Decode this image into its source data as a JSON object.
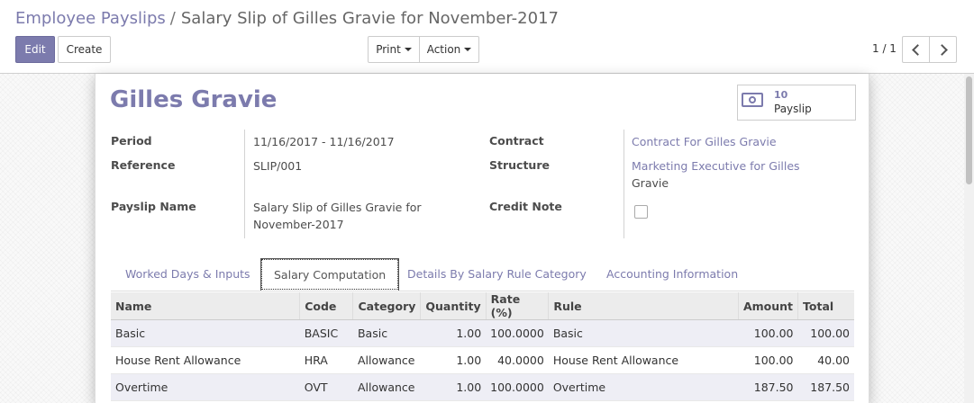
{
  "breadcrumb": {
    "parent": "Employee Payslips",
    "separator": "/",
    "current": "Salary Slip of Gilles Gravie for November-2017"
  },
  "toolbar": {
    "edit": "Edit",
    "create": "Create",
    "print": "Print",
    "action": "Action"
  },
  "pager": {
    "value": "1 / 1"
  },
  "sheet": {
    "title": "Gilles Gravie",
    "smart_button": {
      "count": "10",
      "label": "Payslip",
      "icon": "money-icon"
    },
    "fields": {
      "period_label": "Period",
      "period_value": "11/16/2017 - 11/16/2017",
      "reference_label": "Reference",
      "reference_value": "SLIP/001",
      "payslip_name_label": "Payslip Name",
      "payslip_name_line1": "Salary Slip of Gilles Gravie for",
      "payslip_name_line2": "November-2017",
      "contract_label": "Contract",
      "contract_value": "Contract For Gilles Gravie",
      "structure_label": "Structure",
      "structure_line1": "Marketing Executive for Gilles",
      "structure_line2": "Gravie",
      "credit_note_label": "Credit Note",
      "credit_note_checked": false
    },
    "tabs": [
      {
        "label": "Worked Days & Inputs"
      },
      {
        "label": "Salary Computation"
      },
      {
        "label": "Details By Salary Rule Category"
      },
      {
        "label": "Accounting Information"
      }
    ],
    "table": {
      "headers": [
        "Name",
        "Code",
        "Category",
        "Quantity",
        "Rate (%)",
        "Rule",
        "Amount",
        "Total"
      ],
      "rows": [
        [
          "Basic",
          "BASIC",
          "Basic",
          "1.00",
          "100.0000",
          "Basic",
          "100.00",
          "100.00"
        ],
        [
          "House Rent Allowance",
          "HRA",
          "Allowance",
          "1.00",
          "40.0000",
          "House Rent Allowance",
          "100.00",
          "40.00"
        ],
        [
          "Overtime",
          "OVT",
          "Allowance",
          "1.00",
          "100.0000",
          "Overtime",
          "187.50",
          "187.50"
        ]
      ]
    }
  },
  "colors": {
    "brand": "#7c7bad",
    "row_alt": "#eeeef5"
  }
}
